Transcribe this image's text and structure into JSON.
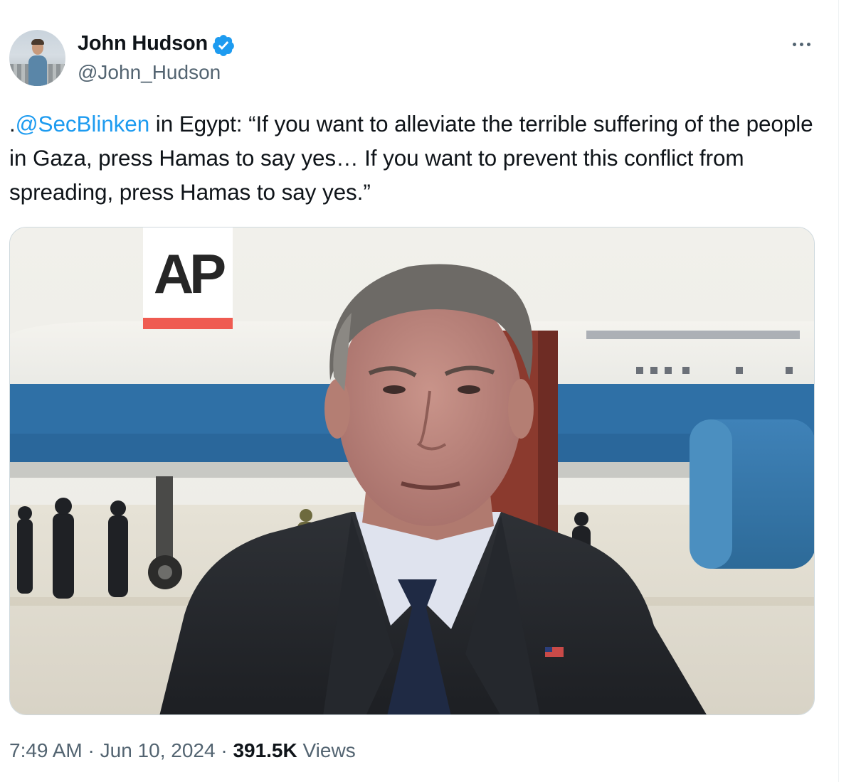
{
  "author": {
    "display_name": "John Hudson",
    "handle": "@John_Hudson",
    "verified": true,
    "verified_icon": "verified-badge-icon",
    "avatar_icon": "profile-photo"
  },
  "menu": {
    "icon": "more-horizontal-icon"
  },
  "tweet": {
    "prefix": ".",
    "mention": "@SecBlinken",
    "text": " in Egypt: “If you want to alleviate the terrible suffering of the people in Gaza, press Hamas to say yes… If you want to prevent this conflict from spreading, press Hamas to say yes.”"
  },
  "media": {
    "type": "video-still",
    "watermark": "AP"
  },
  "footer": {
    "time": "7:49 AM",
    "separator": " · ",
    "date": "Jun 10, 2024",
    "views_count": "391.5K",
    "views_label": " Views"
  },
  "colors": {
    "link": "#1d9bf0",
    "secondary_text": "#536471",
    "primary_text": "#0f1419",
    "verified": "#1d9bf0",
    "ap_red": "#ef5b51"
  }
}
